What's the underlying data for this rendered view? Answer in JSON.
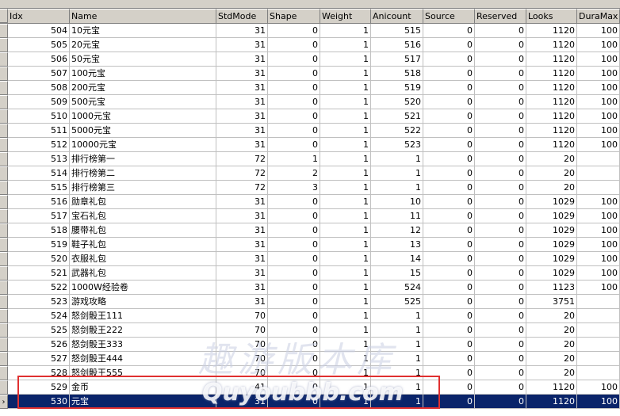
{
  "columns": [
    "Idx",
    "Name",
    "StdMode",
    "Shape",
    "Weight",
    "Anicount",
    "Source",
    "Reserved",
    "Looks",
    "DuraMax"
  ],
  "rows": [
    [
      "504",
      "10元宝",
      "31",
      "0",
      "1",
      "515",
      "0",
      "0",
      "1120",
      "100"
    ],
    [
      "505",
      "20元宝",
      "31",
      "0",
      "1",
      "516",
      "0",
      "0",
      "1120",
      "100"
    ],
    [
      "506",
      "50元宝",
      "31",
      "0",
      "1",
      "517",
      "0",
      "0",
      "1120",
      "100"
    ],
    [
      "507",
      "100元宝",
      "31",
      "0",
      "1",
      "518",
      "0",
      "0",
      "1120",
      "100"
    ],
    [
      "508",
      "200元宝",
      "31",
      "0",
      "1",
      "519",
      "0",
      "0",
      "1120",
      "100"
    ],
    [
      "509",
      "500元宝",
      "31",
      "0",
      "1",
      "520",
      "0",
      "0",
      "1120",
      "100"
    ],
    [
      "510",
      "1000元宝",
      "31",
      "0",
      "1",
      "521",
      "0",
      "0",
      "1120",
      "100"
    ],
    [
      "511",
      "5000元宝",
      "31",
      "0",
      "1",
      "522",
      "0",
      "0",
      "1120",
      "100"
    ],
    [
      "512",
      "10000元宝",
      "31",
      "0",
      "1",
      "523",
      "0",
      "0",
      "1120",
      "100"
    ],
    [
      "513",
      "排行榜第一",
      "72",
      "1",
      "1",
      "1",
      "0",
      "0",
      "20",
      ""
    ],
    [
      "514",
      "排行榜第二",
      "72",
      "2",
      "1",
      "1",
      "0",
      "0",
      "20",
      ""
    ],
    [
      "515",
      "排行榜第三",
      "72",
      "3",
      "1",
      "1",
      "0",
      "0",
      "20",
      ""
    ],
    [
      "516",
      "勋章礼包",
      "31",
      "0",
      "1",
      "10",
      "0",
      "0",
      "1029",
      "100"
    ],
    [
      "517",
      "宝石礼包",
      "31",
      "0",
      "1",
      "11",
      "0",
      "0",
      "1029",
      "100"
    ],
    [
      "518",
      "腰带礼包",
      "31",
      "0",
      "1",
      "12",
      "0",
      "0",
      "1029",
      "100"
    ],
    [
      "519",
      "鞋子礼包",
      "31",
      "0",
      "1",
      "13",
      "0",
      "0",
      "1029",
      "100"
    ],
    [
      "520",
      "衣服礼包",
      "31",
      "0",
      "1",
      "14",
      "0",
      "0",
      "1029",
      "100"
    ],
    [
      "521",
      "武器礼包",
      "31",
      "0",
      "1",
      "15",
      "0",
      "0",
      "1029",
      "100"
    ],
    [
      "522",
      "1000W经验卷",
      "31",
      "0",
      "1",
      "524",
      "0",
      "0",
      "1123",
      "100"
    ],
    [
      "523",
      "游戏攻略",
      "31",
      "0",
      "1",
      "525",
      "0",
      "0",
      "3751",
      ""
    ],
    [
      "524",
      "怒剑骰王111",
      "70",
      "0",
      "1",
      "1",
      "0",
      "0",
      "20",
      ""
    ],
    [
      "525",
      "怒剑骰王222",
      "70",
      "0",
      "1",
      "1",
      "0",
      "0",
      "20",
      ""
    ],
    [
      "526",
      "怒剑骰王333",
      "70",
      "0",
      "1",
      "1",
      "0",
      "0",
      "20",
      ""
    ],
    [
      "527",
      "怒剑骰王444",
      "70",
      "0",
      "1",
      "1",
      "0",
      "0",
      "20",
      ""
    ],
    [
      "528",
      "怒剑骰王555",
      "70",
      "0",
      "1",
      "1",
      "0",
      "0",
      "20",
      ""
    ],
    [
      "529",
      "金币",
      "41",
      "0",
      "1",
      "1",
      "0",
      "0",
      "1120",
      "100"
    ],
    [
      "530",
      "元宝",
      "31",
      "0",
      "1",
      "1",
      "0",
      "0",
      "1120",
      "100"
    ]
  ],
  "selected_row_index": 26,
  "watermark": {
    "line1": "趣游版本库",
    "line2": "Quyoubbb.com"
  },
  "colors": {
    "selection": "#0a246a",
    "highlight_box": "#e03030",
    "header_bg": "#d4d0c8"
  }
}
